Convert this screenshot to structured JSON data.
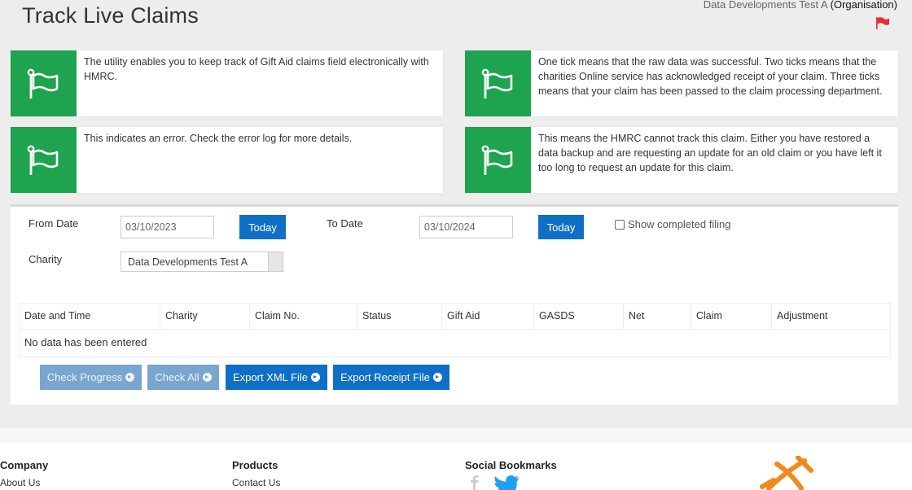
{
  "header": {
    "title": "Track Live Claims",
    "org_name": "Data Developments Test A",
    "org_type": "(Organisation)"
  },
  "info_cards": [
    {
      "text": "The utility enables you to keep track of Gift Aid claims field electronically with HMRC."
    },
    {
      "text": "One tick means that the raw data was successful. Two ticks means that the charities Online service has acknowledged receipt of your claim. Three ticks means that your claim has been passed to the claim processing department."
    },
    {
      "text": "This indicates an error. Check the error log for more details."
    },
    {
      "text": "This means the HMRC cannot track this claim. Either you have restored a data backup and are requesting an update for an old claim or you have left it too long to request an update for this claim."
    }
  ],
  "filters": {
    "from_label": "From Date",
    "from_value": "03/10/2023",
    "to_label": "To Date",
    "to_value": "03/10/2024",
    "today_label": "Today",
    "show_completed_label": "Show completed filing",
    "charity_label": "Charity",
    "charity_value": "Data Developments Test A"
  },
  "table": {
    "columns": [
      "Date and Time",
      "Charity",
      "Claim No.",
      "Status",
      "Gift Aid",
      "GASDS",
      "Net",
      "Claim",
      "Adjustment"
    ],
    "empty_message": "No data has been entered"
  },
  "actions": {
    "check_progress": "Check Progress",
    "check_all": "Check All",
    "export_xml": "Export XML File",
    "export_receipt": "Export Receipt File"
  },
  "footer": {
    "company_heading": "Company",
    "company_link": "About Us",
    "products_heading": "Products",
    "products_link": "Contact Us",
    "social_heading": "Social Bookmarks"
  },
  "colors": {
    "green": "#1ea34f",
    "blue": "#0f6fc6",
    "flag_red": "#e53030",
    "logo_orange": "#f08a1c"
  }
}
